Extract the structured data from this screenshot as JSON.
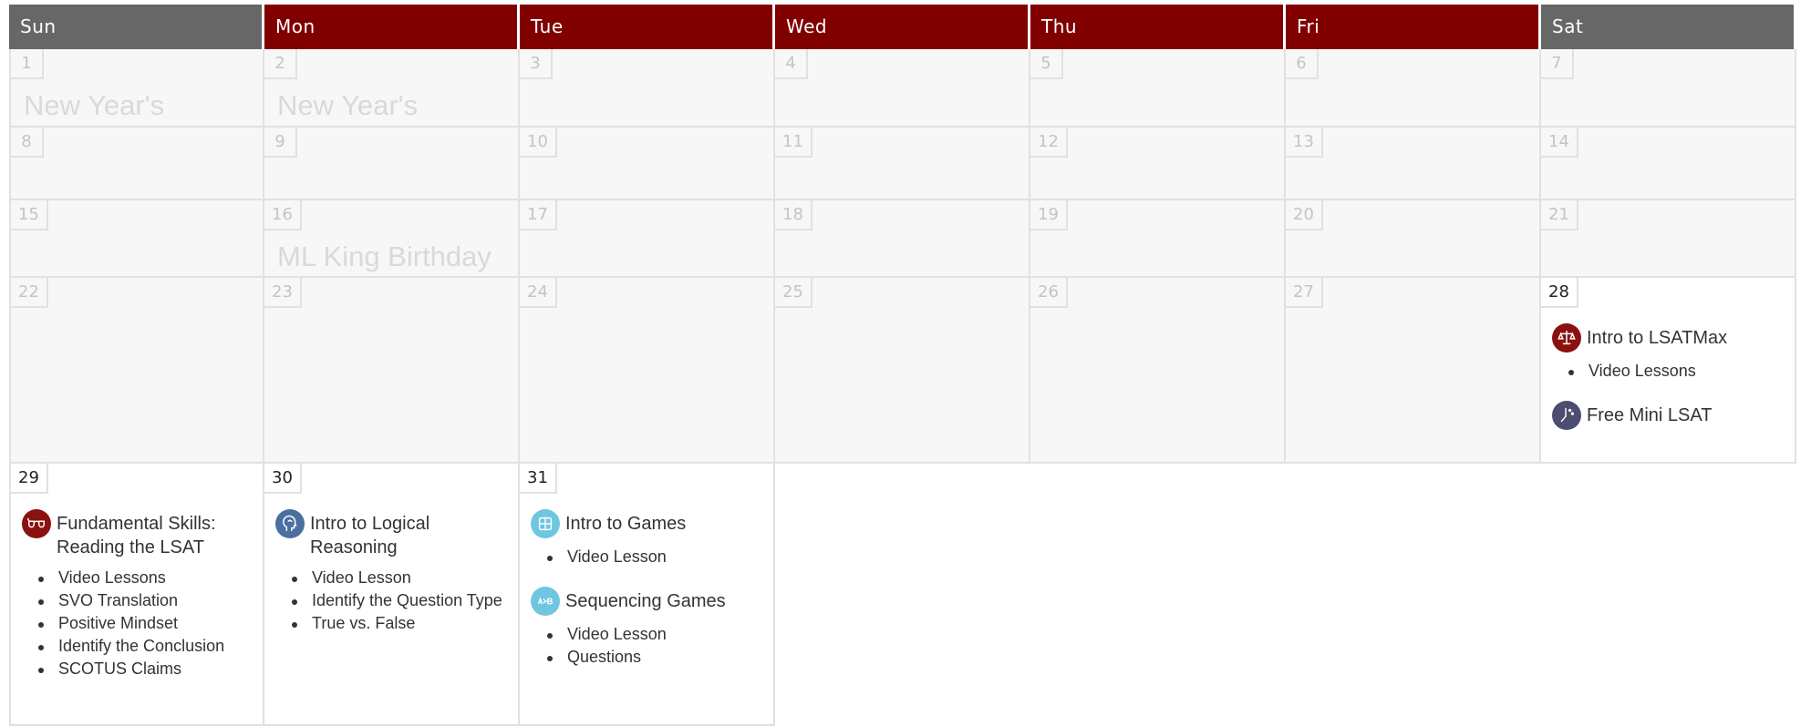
{
  "header": {
    "days": [
      "Sun",
      "Mon",
      "Tue",
      "Wed",
      "Thu",
      "Fri",
      "Sat"
    ]
  },
  "colors": {
    "weekend_header": "#676767",
    "weekday_header": "#800000",
    "icon_red": "#8b1010",
    "icon_slate": "#4b4e70",
    "icon_blue": "#4a6fa0",
    "icon_cyan": "#6fc6e0"
  },
  "days": {
    "d1": {
      "num": "1",
      "holiday": "New Year's"
    },
    "d2": {
      "num": "2",
      "holiday": "New Year's"
    },
    "d3": {
      "num": "3"
    },
    "d4": {
      "num": "4"
    },
    "d5": {
      "num": "5"
    },
    "d6": {
      "num": "6"
    },
    "d7": {
      "num": "7"
    },
    "d8": {
      "num": "8"
    },
    "d9": {
      "num": "9"
    },
    "d10": {
      "num": "10"
    },
    "d11": {
      "num": "11"
    },
    "d12": {
      "num": "12"
    },
    "d13": {
      "num": "13"
    },
    "d14": {
      "num": "14"
    },
    "d15": {
      "num": "15"
    },
    "d16": {
      "num": "16",
      "holiday": "ML King Birthday"
    },
    "d17": {
      "num": "17"
    },
    "d18": {
      "num": "18"
    },
    "d19": {
      "num": "19"
    },
    "d20": {
      "num": "20"
    },
    "d21": {
      "num": "21"
    },
    "d22": {
      "num": "22"
    },
    "d23": {
      "num": "23"
    },
    "d24": {
      "num": "24"
    },
    "d25": {
      "num": "25"
    },
    "d26": {
      "num": "26"
    },
    "d27": {
      "num": "27"
    },
    "d28": {
      "num": "28",
      "events": [
        {
          "title": "Intro to LSATMax",
          "icon": "scales-icon",
          "items": [
            "Video Lessons"
          ]
        },
        {
          "title": "Free Mini LSAT",
          "icon": "clock-icon",
          "items": []
        }
      ]
    },
    "d29": {
      "num": "29",
      "events": [
        {
          "title": "Fundamental Skills: Reading the LSAT",
          "icon": "glasses-icon",
          "items": [
            "Video Lessons",
            "SVO Translation",
            "Positive Mindset",
            "Identify the Conclusion",
            "SCOTUS Claims"
          ]
        }
      ]
    },
    "d30": {
      "num": "30",
      "events": [
        {
          "title": "Intro to Logical Reasoning",
          "icon": "head-icon",
          "items": [
            "Video Lesson",
            "Identify the Question Type",
            "True vs. False"
          ]
        }
      ]
    },
    "d31": {
      "num": "31",
      "events": [
        {
          "title": "Intro to Games",
          "icon": "puzzle-icon",
          "items": [
            "Video Lesson"
          ]
        },
        {
          "title": "Sequencing Games",
          "icon": "sequence-icon",
          "items": [
            "Video Lesson",
            "Questions"
          ]
        }
      ]
    }
  }
}
